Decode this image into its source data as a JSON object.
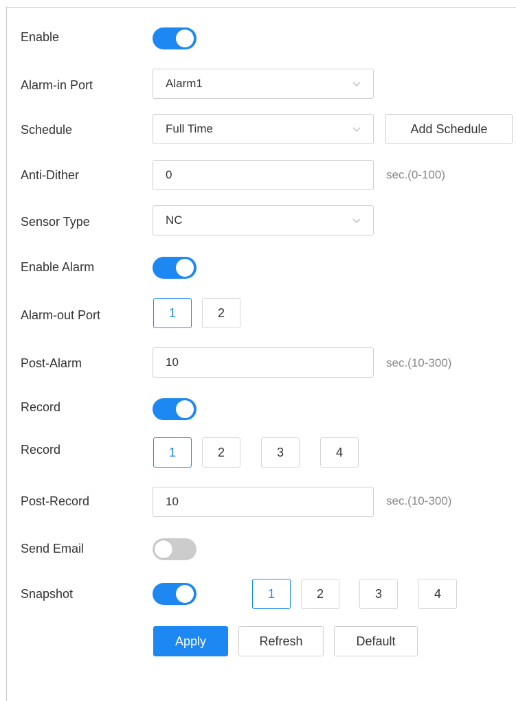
{
  "enable": {
    "label": "Enable",
    "on": true
  },
  "alarm_in_port": {
    "label": "Alarm-in Port",
    "value": "Alarm1"
  },
  "schedule": {
    "label": "Schedule",
    "value": "Full Time",
    "add_label": "Add Schedule"
  },
  "anti_dither": {
    "label": "Anti-Dither",
    "value": "0",
    "hint": "sec.(0-100)"
  },
  "sensor_type": {
    "label": "Sensor Type",
    "value": "NC"
  },
  "enable_alarm": {
    "label": "Enable Alarm",
    "on": true
  },
  "alarm_out_port": {
    "label": "Alarm-out Port",
    "options": [
      "1",
      "2"
    ],
    "selected": [
      "1"
    ]
  },
  "post_alarm": {
    "label": "Post-Alarm",
    "value": "10",
    "hint": "sec.(10-300)"
  },
  "record_toggle": {
    "label": "Record",
    "on": true
  },
  "record_channels": {
    "label": "Record",
    "options": [
      "1",
      "2",
      "3",
      "4"
    ],
    "selected": [
      "1"
    ]
  },
  "post_record": {
    "label": "Post-Record",
    "value": "10",
    "hint": "sec.(10-300)"
  },
  "send_email": {
    "label": "Send Email",
    "on": false
  },
  "snapshot": {
    "label": "Snapshot",
    "on": true,
    "options": [
      "1",
      "2",
      "3",
      "4"
    ],
    "selected": [
      "1"
    ]
  },
  "actions": {
    "apply": "Apply",
    "refresh": "Refresh",
    "default": "Default"
  },
  "colors": {
    "accent": "#1e88f2",
    "toggle_off": "#cccccc",
    "border": "#cfcfcf",
    "hint_text": "#888888"
  }
}
